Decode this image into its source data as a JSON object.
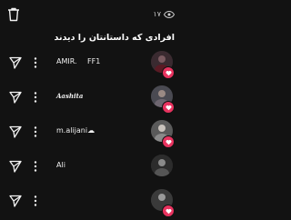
{
  "header": {
    "view_count": "۱۷",
    "trash_icon": "trash-icon",
    "eye_icon": "eye-icon"
  },
  "viewers_heading": "افرادی که داستانتان را دیدند",
  "viewers": [
    {
      "username": "AMIR.",
      "extra": "FF1",
      "liked": true
    },
    {
      "username": "Aashita",
      "extra": "",
      "liked": true
    },
    {
      "username": "m.alijani☁",
      "extra": "",
      "liked": true
    },
    {
      "username": "Ali",
      "extra": "",
      "liked": false
    },
    {
      "username": "",
      "extra": "",
      "liked": true
    }
  ],
  "colors": {
    "background": "#121212",
    "like_badge": "#e8335f"
  }
}
